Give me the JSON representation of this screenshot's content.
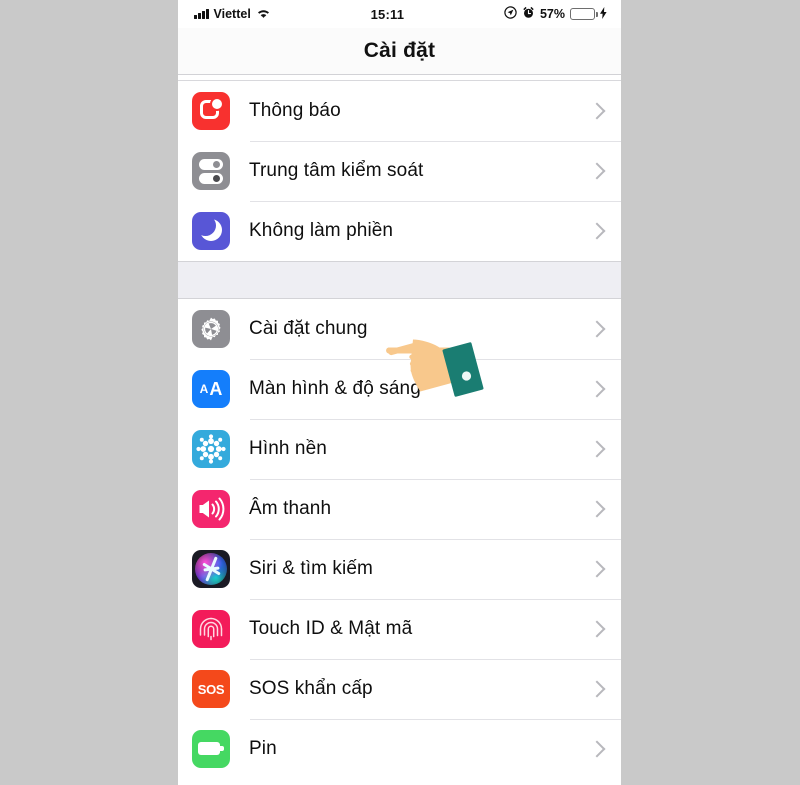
{
  "statusbar": {
    "signal_icon": "signal-bars-icon",
    "carrier": "Viettel",
    "wifi_icon": "wifi-icon",
    "time": "15:11",
    "location_icon": "location-arrow-icon",
    "alarm_icon": "alarm-clock-icon",
    "battery_percent": "57%",
    "battery_icon": "battery-low-power-icon",
    "charging_icon": "lightning-bolt-icon",
    "battery_fill_color": "#ffcc00",
    "battery_level": 57
  },
  "navbar": {
    "title": "Cài đặt"
  },
  "groups": [
    {
      "rows": [
        {
          "label": "Thông báo",
          "icon": "notifications-icon",
          "color": "#f8312f",
          "chevron": "chevron-right-icon"
        },
        {
          "label": "Trung tâm kiểm soát",
          "icon": "control-center-icon",
          "color": "#8e8e93",
          "chevron": "chevron-right-icon"
        },
        {
          "label": "Không làm phiền",
          "icon": "do-not-disturb-moon-icon",
          "color": "#5856d6",
          "chevron": "chevron-right-icon"
        }
      ]
    },
    {
      "rows": [
        {
          "label": "Cài đặt chung",
          "icon": "general-gear-icon",
          "color": "#8e8e93",
          "chevron": "chevron-right-icon"
        },
        {
          "label": "Màn hình & độ sáng",
          "icon": "display-brightness-aa-icon",
          "color": "#147efb",
          "chevron": "chevron-right-icon"
        },
        {
          "label": "Hình nền",
          "icon": "wallpaper-icon",
          "color": "#34aadc",
          "chevron": "chevron-right-icon"
        },
        {
          "label": "Âm thanh",
          "icon": "sounds-speaker-icon",
          "color": "#f4266e",
          "chevron": "chevron-right-icon"
        },
        {
          "label": "Siri & tìm kiếm",
          "icon": "siri-icon",
          "color": "#1a1a24",
          "chevron": "chevron-right-icon"
        },
        {
          "label": "Touch ID & Mật mã",
          "icon": "touch-id-fingerprint-icon",
          "color": "#f31b5a",
          "chevron": "chevron-right-icon"
        },
        {
          "label": "SOS khẩn cấp",
          "icon": "emergency-sos-icon",
          "color": "#f4491b",
          "chevron": "chevron-right-icon",
          "badge": "SOS"
        },
        {
          "label": "Pin",
          "icon": "battery-icon",
          "color": "#45d862",
          "chevron": "chevron-right-icon"
        }
      ]
    }
  ],
  "overlay": {
    "hand_cursor_icon": "pointing-hand-cursor",
    "skin_color": "#f8c88c",
    "cuff_color": "#1a7d72"
  }
}
